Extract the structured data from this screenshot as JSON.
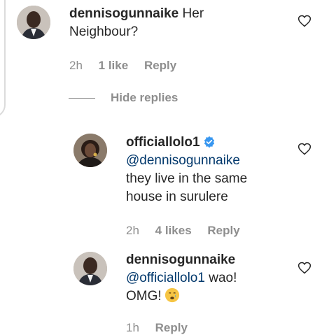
{
  "comments": [
    {
      "username": "dennisogunnaike",
      "text": "Her Neighbour?",
      "time": "2h",
      "likes": "1 like",
      "reply": "Reply"
    },
    {
      "username": "officiallolo1",
      "verified": true,
      "mention": "@dennisogunnaike",
      "text": "they live in the same house in surulere",
      "time": "2h",
      "likes": "4 likes",
      "reply": "Reply"
    },
    {
      "username": "dennisogunnaike",
      "mention": "@officiallolo1",
      "text_part1": "wao!",
      "text_part2": "OMG!",
      "emoji_name": "crying-face",
      "time": "1h",
      "likes": "",
      "reply": "Reply"
    }
  ],
  "hide_replies_label": "Hide replies",
  "colors": {
    "text": "#262626",
    "meta": "#8e8e8e",
    "mention": "#00376b",
    "verified": "#3897f0"
  }
}
